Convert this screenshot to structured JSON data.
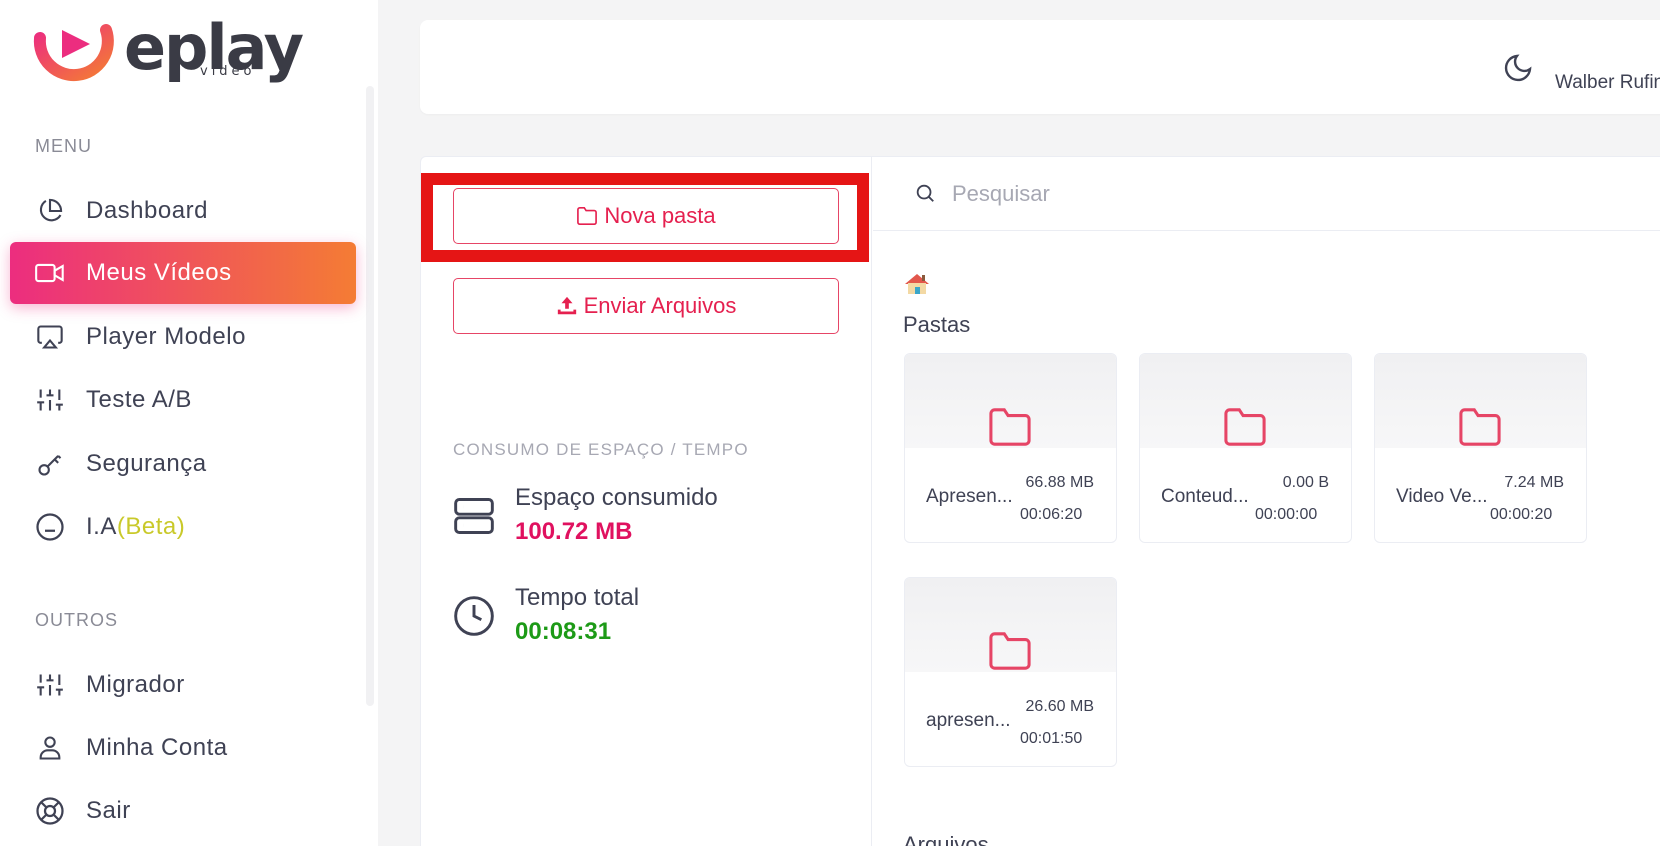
{
  "brand": {
    "name": "eplay",
    "sub": "vídeo",
    "accent": "#ec2d7f",
    "accent2": "#f47c34"
  },
  "sidebar": {
    "menu_label": "MENU",
    "items": [
      {
        "label": "Dashboard",
        "icon": "pie-chart-icon",
        "active": false
      },
      {
        "label": "Meus Vídeos",
        "icon": "video-camera-icon",
        "active": true
      },
      {
        "label": "Player Modelo",
        "icon": "airplay-icon",
        "active": false
      },
      {
        "label": "Teste A/B",
        "icon": "sliders-icon",
        "active": false
      },
      {
        "label": "Segurança",
        "icon": "key-icon",
        "active": false
      },
      {
        "label": "I.A ",
        "badge": "(Beta)",
        "icon": "smile-icon",
        "active": false
      }
    ],
    "others_label": "OUTROS",
    "others": [
      {
        "label": "Migrador",
        "icon": "sliders-icon"
      },
      {
        "label": "Minha Conta",
        "icon": "user-icon"
      },
      {
        "label": "Sair",
        "icon": "lifebuoy-icon"
      }
    ]
  },
  "topbar": {
    "user_name": "Walber Rufino",
    "theme_icon": "moon-icon"
  },
  "actions": {
    "new_folder": "Nova pasta",
    "upload": "Enviar Arquivos"
  },
  "usage": {
    "title": "CONSUMO DE ESPAÇO / TEMPO",
    "space_label": "Espaço consumido",
    "space_value": "100.72 MB",
    "space_color": "#e0115f",
    "time_label": "Tempo total",
    "time_value": "00:08:31",
    "time_color": "#1d9a17"
  },
  "search": {
    "placeholder": "Pesquisar",
    "value": ""
  },
  "folders_title": "Pastas",
  "folders": [
    {
      "name": "Apresen...",
      "size": "66.88 MB",
      "duration": "00:06:20"
    },
    {
      "name": "Conteud...",
      "size": "0.00 B",
      "duration": "00:00:00"
    },
    {
      "name": "Video Ve...",
      "size": "7.24 MB",
      "duration": "00:00:20"
    },
    {
      "name": "apresen...",
      "size": "26.60 MB",
      "duration": "00:01:50"
    }
  ],
  "files_title": "Arquivos"
}
